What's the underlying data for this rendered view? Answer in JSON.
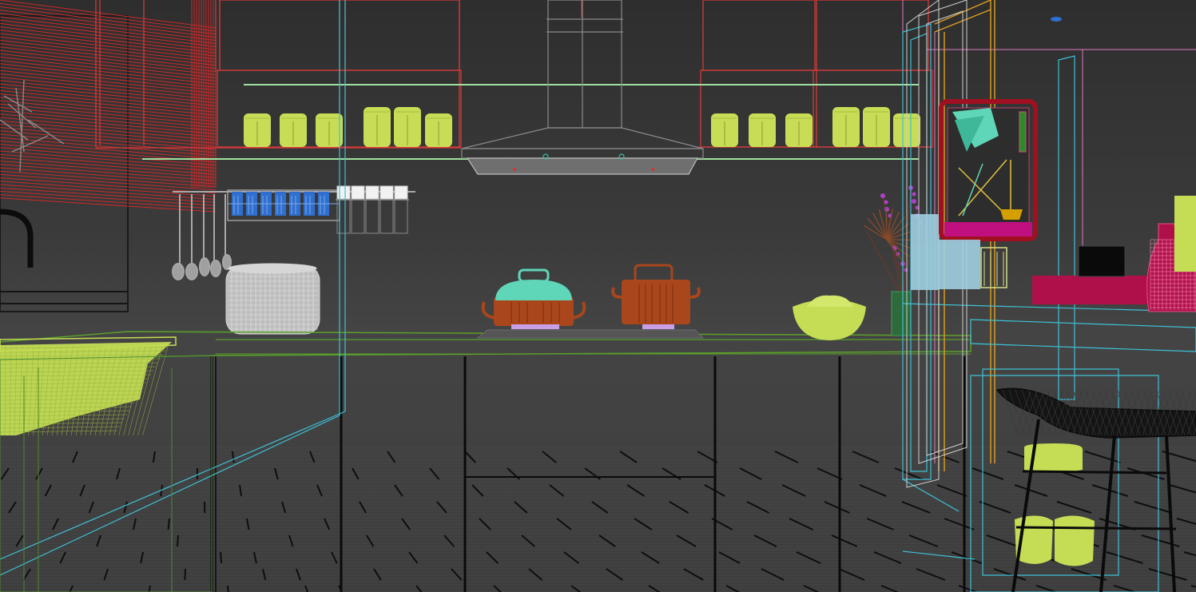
{
  "viewport": {
    "render_mode": "wireframe",
    "scene": "kitchen"
  },
  "palette": {
    "background": "#3a3a3a",
    "cabinet_wire": "#e03a3a",
    "blinds": "#c92a2a",
    "shelf_glass": "#9fe09f",
    "jar": "#c8dd55",
    "counter_edge": "#5aa02a",
    "counter_legs": "#0a0a0a",
    "floor_lines": "#111111",
    "hood": "#8a8a8a",
    "pot_lid": "#5fd6b8",
    "pot_body": "#a9461b",
    "rack_bottles": "#2f6fd0",
    "cyan_frame": "#3ec1d6",
    "orange_frame": "#e0a020",
    "magenta_shelf": "#b0104a",
    "picture_frame": "#a01020",
    "stool": "#0a0a0a"
  },
  "objects": {
    "wall_cabinets": "wall-cabinets",
    "jars": "storage-jars",
    "range_hood": "range-hood",
    "spice_rack": "spice-rack",
    "utensil_rail": "utensil-rail",
    "rice_cooker": "rice-cooker",
    "cooktop": "cooktop",
    "lidded_pot": "lidded-pot",
    "stock_pot": "stock-pot",
    "fruit_bowl": "fruit-bowl",
    "flower_vase": "flower-vase",
    "wall_picture": "wall-picture",
    "bar_stool": "bar-stool",
    "decanter": "decanter",
    "sink": "sink",
    "window_blinds": "window-blinds"
  }
}
